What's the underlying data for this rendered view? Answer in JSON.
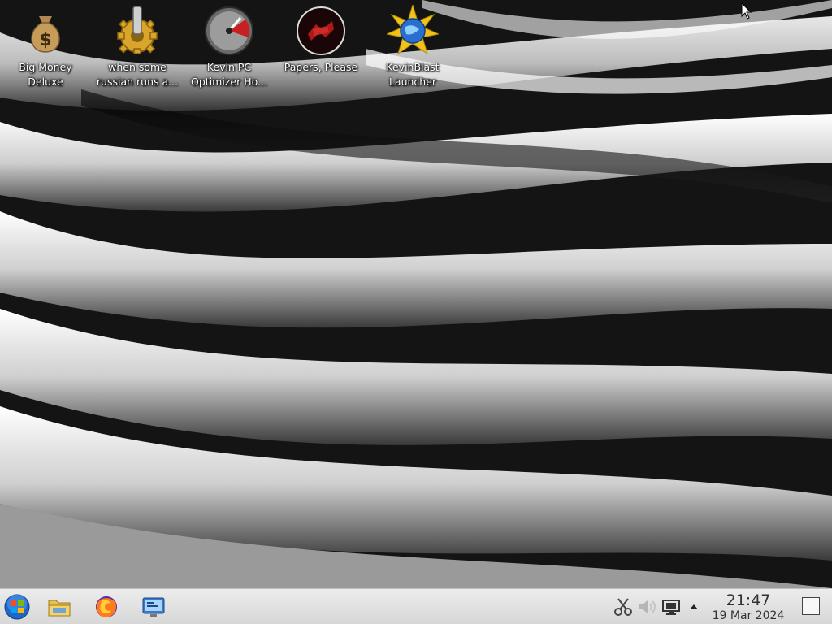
{
  "desktop": {
    "icons": [
      {
        "label": "Big Money\nDeluxe",
        "icon": "money-bag-icon"
      },
      {
        "label": "when some\nrussian runs a...",
        "icon": "gear-icon"
      },
      {
        "label": "Kevin PC\nOptimizer Ho...",
        "icon": "gauge-icon"
      },
      {
        "label": "Papers, Please",
        "icon": "papers-please-icon"
      },
      {
        "label": "KevinBlast\nLauncher",
        "icon": "star-globe-icon"
      }
    ]
  },
  "taskbar": {
    "launchers": [
      "start-orb-icon",
      "file-manager-icon",
      "firefox-icon",
      "control-panel-icon"
    ],
    "tray": [
      "scissors-icon",
      "volume-icon",
      "display-icon",
      "chevron-up-icon"
    ],
    "clock": {
      "time": "21:47",
      "date": "19 Mar 2024"
    }
  },
  "colors": {
    "taskbar_bg": "#e2e2e2",
    "accent": "#1e66c8"
  }
}
